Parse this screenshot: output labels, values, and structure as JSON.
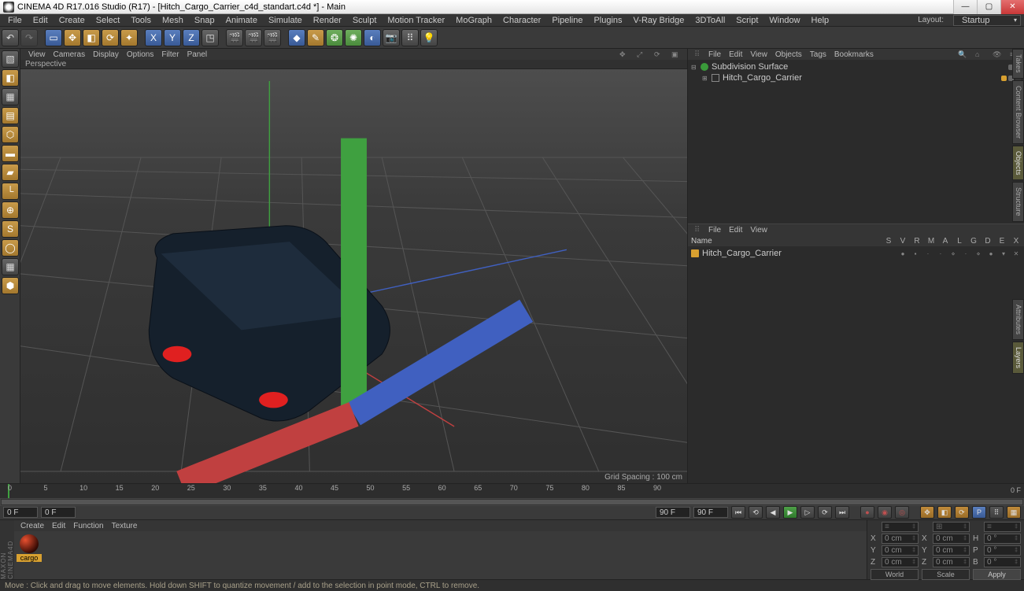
{
  "title": "CINEMA 4D R17.016 Studio (R17) - [Hitch_Cargo_Carrier_c4d_standart.c4d *] - Main",
  "menu": [
    "File",
    "Edit",
    "Create",
    "Select",
    "Tools",
    "Mesh",
    "Snap",
    "Animate",
    "Simulate",
    "Render",
    "Sculpt",
    "Motion Tracker",
    "MoGraph",
    "Character",
    "Pipeline",
    "Plugins",
    "V-Ray Bridge",
    "3DToAll",
    "Script",
    "Window",
    "Help"
  ],
  "layout_label": "Layout:",
  "layout_value": "Startup",
  "view_menu": [
    "View",
    "Cameras",
    "Display",
    "Options",
    "Filter",
    "Panel"
  ],
  "view_label": "Perspective",
  "grid_spacing": "Grid Spacing : 100 cm",
  "obj_menu": [
    "File",
    "Edit",
    "View",
    "Objects",
    "Tags",
    "Bookmarks"
  ],
  "tree": {
    "root": {
      "name": "Subdivision Surface"
    },
    "child": {
      "name": "Hitch_Cargo_Carrier"
    }
  },
  "layers_menu": [
    "File",
    "Edit",
    "View"
  ],
  "layers_cols": [
    "Name",
    "S",
    "V",
    "R",
    "M",
    "A",
    "L",
    "G",
    "D",
    "E",
    "X"
  ],
  "layer": {
    "name": "Hitch_Cargo_Carrier"
  },
  "timeline": {
    "ticks": [
      "0",
      "5",
      "10",
      "15",
      "20",
      "25",
      "30",
      "35",
      "40",
      "45",
      "50",
      "55",
      "60",
      "65",
      "70",
      "75",
      "80",
      "85",
      "90"
    ],
    "end": "0 F"
  },
  "playback": {
    "start": "0 F",
    "startB": "0 F",
    "endA": "90 F",
    "endB": "90 F"
  },
  "mat_menu": [
    "Create",
    "Edit",
    "Function",
    "Texture"
  ],
  "material": {
    "name": "cargo"
  },
  "coord": {
    "hdr": [
      "≡",
      "⊞",
      "≡"
    ],
    "rows": [
      {
        "l": "X",
        "a": "0 cm",
        "l2": "X",
        "b": "0 cm",
        "l3": "H",
        "c": "0 °"
      },
      {
        "l": "Y",
        "a": "0 cm",
        "l2": "Y",
        "b": "0 cm",
        "l3": "P",
        "c": "0 °"
      },
      {
        "l": "Z",
        "a": "0 cm",
        "l2": "Z",
        "b": "0 cm",
        "l3": "B",
        "c": "0 °"
      }
    ],
    "sel": [
      "World",
      "Scale",
      "Apply"
    ]
  },
  "status": "Move : Click and drag to move elements. Hold down SHIFT to quantize movement / add to the selection in point mode, CTRL to remove.",
  "side_tabs": [
    "Takes",
    "Content Browser",
    "Objects",
    "Structure",
    "Attributes",
    "Layers"
  ],
  "maxon": "MAXON CINEMA4D"
}
